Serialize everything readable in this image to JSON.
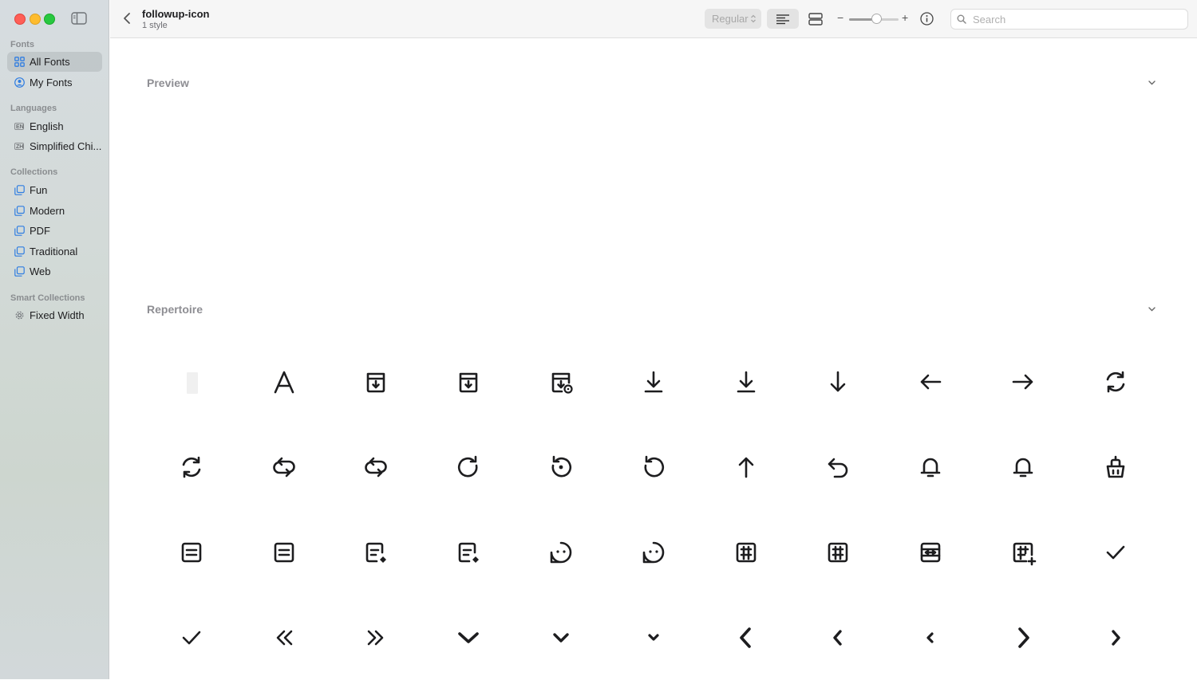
{
  "window": {
    "title": "followup-icon",
    "subtitle": "1 style"
  },
  "sidebar": {
    "sections": [
      {
        "label": "Fonts",
        "items": [
          {
            "label": "All Fonts",
            "icon": "grid-icon",
            "selected": true
          },
          {
            "label": "My Fonts",
            "icon": "person-circle-icon",
            "selected": false
          }
        ]
      },
      {
        "label": "Languages",
        "items": [
          {
            "label": "English",
            "icon": "EN",
            "selected": false
          },
          {
            "label": "Simplified Chi...",
            "icon": "ZH",
            "selected": false
          }
        ]
      },
      {
        "label": "Collections",
        "items": [
          {
            "label": "Fun",
            "icon": "collection-icon"
          },
          {
            "label": "Modern",
            "icon": "collection-icon"
          },
          {
            "label": "PDF",
            "icon": "collection-icon"
          },
          {
            "label": "Traditional",
            "icon": "collection-icon"
          },
          {
            "label": "Web",
            "icon": "collection-icon"
          }
        ]
      },
      {
        "label": "Smart Collections",
        "items": [
          {
            "label": "Fixed Width",
            "icon": "gear-icon"
          }
        ]
      }
    ]
  },
  "toolbar": {
    "style_value": "Regular",
    "search_placeholder": "Search",
    "zoom_minus": "−",
    "zoom_plus": "+",
    "zoom_level": 0.55
  },
  "main": {
    "preview_title": "Preview",
    "repertoire_title": "Repertoire",
    "glyphs": [
      "blank",
      "letter-a",
      "archive-down",
      "archive-down",
      "archive-view",
      "download-line",
      "download-line",
      "arrow-down",
      "arrow-left",
      "arrow-right",
      "sync",
      "sync",
      "repeat",
      "repeat",
      "rotate-cw",
      "history",
      "rotate-ccw",
      "arrow-up",
      "undo",
      "bell",
      "bell",
      "basket",
      "document",
      "document",
      "document-edit",
      "document-edit",
      "chat",
      "chat",
      "table",
      "table",
      "table-split",
      "table-add",
      "check",
      "check",
      "chevrons-left",
      "chevrons-right",
      "chevron-down-bold",
      "chevron-down",
      "chevron-down-small",
      "chevron-left-bold",
      "chevron-left",
      "chevron-left-small",
      "chevron-right-bold",
      "chevron-right"
    ]
  },
  "colors": {
    "accent": "#ff5f57",
    "sidebar_bg": "#d3dad8",
    "glyph": "#1d1d1f"
  }
}
